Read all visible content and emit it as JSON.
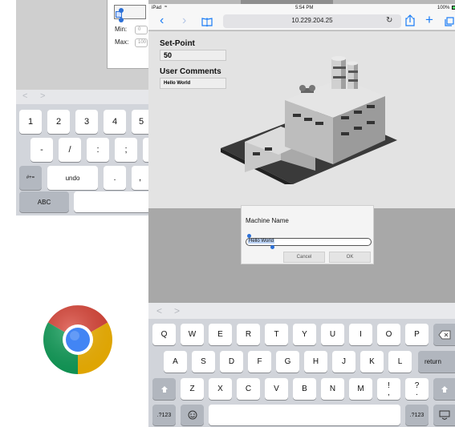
{
  "back_panel": {
    "min_label": "Min:",
    "min_value": "0",
    "max_label": "Max:",
    "max_value": "100",
    "nav_back": "<",
    "nav_forward": ">",
    "keyboard": {
      "row1": [
        "1",
        "2",
        "3",
        "4",
        "5"
      ],
      "row2": [
        "-",
        "/",
        ":",
        ";"
      ],
      "row3_left": "#+=",
      "row3_mid": "undo",
      "row3_keys": [
        ".",
        ","
      ],
      "row4_left": "ABC"
    }
  },
  "status_bar": {
    "carrier": "iPad",
    "time": "5:54 PM",
    "battery": "100%"
  },
  "browser": {
    "url": "10.229.204.25",
    "icons": [
      "back-icon",
      "forward-icon",
      "bookmarks-icon",
      "reload-icon",
      "share-icon",
      "new-tab-icon",
      "tabs-icon"
    ]
  },
  "page": {
    "setpoint_label": "Set-Point",
    "setpoint_value": "50",
    "comments_label": "User Comments",
    "comments_value": "Hello World"
  },
  "dialog": {
    "title": "Machine Name",
    "input_value": "Hello World",
    "cancel_label": "Cancel",
    "ok_label": "OK"
  },
  "keyboard": {
    "bar_back": "<",
    "bar_forward": ">",
    "row1": [
      "Q",
      "W",
      "E",
      "R",
      "T",
      "Y",
      "U",
      "I",
      "O",
      "P"
    ],
    "row2": [
      "A",
      "S",
      "D",
      "F",
      "G",
      "H",
      "J",
      "K",
      "L"
    ],
    "return_label": "return",
    "row3": [
      "Z",
      "X",
      "C",
      "V",
      "B",
      "N",
      "M",
      "!",
      "?"
    ],
    "row3_sub": [
      ",",
      "."
    ],
    "bottom_left": ".?123",
    "bottom_right": ".?123"
  },
  "colors": {
    "chrome_red": "#db4437",
    "chrome_green": "#0f9d58",
    "chrome_yellow": "#f4b400",
    "chrome_blue": "#4285f4",
    "ios_blue": "#1a7cf5",
    "selection_blue": "#2b6fd6"
  }
}
